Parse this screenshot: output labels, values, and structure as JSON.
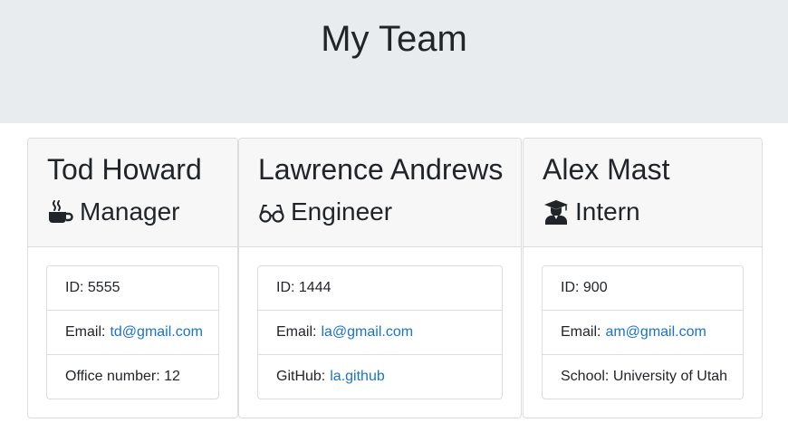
{
  "header": {
    "title": "My Team"
  },
  "cards": [
    {
      "name": "Tod Howard",
      "role": "Manager",
      "icon": "coffee-icon",
      "id_label": "ID: 5555",
      "email_label": "Email:",
      "email": "td@gmail.com",
      "extra_label": "Office number: 12"
    },
    {
      "name": "Lawrence Andrews",
      "role": "Engineer",
      "icon": "glasses-icon",
      "id_label": "ID: 1444",
      "email_label": "Email:",
      "email": "la@gmail.com",
      "extra_label": "GitHub:",
      "extra_link": "la.github"
    },
    {
      "name": "Alex Mast",
      "role": "Intern",
      "icon": "graduate-icon",
      "id_label": "ID: 900",
      "email_label": "Email:",
      "email": "am@gmail.com",
      "extra_label": "School: University of Utah"
    }
  ],
  "colors": {
    "header_bg": "#e9ecef",
    "card_header_bg": "#f7f7f7",
    "link": "#1a73c8"
  }
}
